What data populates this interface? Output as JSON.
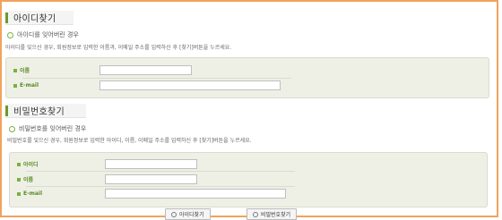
{
  "find_id": {
    "section_title": "아이디찾기",
    "subtitle": "아이디를 잊어버린 경우",
    "description": "아이디를 잊으신 경우, 회원정보로 입력한 이름과, 이메일 주소를 입력하신 후 [찾기]버튼을 누르세요.",
    "fields": [
      {
        "label": "이름",
        "value": ""
      },
      {
        "label": "E-mail",
        "value": ""
      }
    ]
  },
  "find_password": {
    "section_title": "비밀번호찾기",
    "subtitle": "비밀번호를 잊어버린 경우",
    "description": "비밀번호를 잊으신 경우, 회원정보로 입력한 아이디, 이름, 이메일 주소를 입력하신 후 [찾기]버튼을 누르세요.",
    "fields": [
      {
        "label": "아이디",
        "value": ""
      },
      {
        "label": "이름",
        "value": ""
      },
      {
        "label": "E-mail",
        "value": ""
      }
    ]
  },
  "buttons": {
    "find_id": "아이디찾기",
    "find_password": "비밀번호찾기"
  },
  "colors": {
    "accent_green": "#7bb040",
    "frame_orange": "#f1a35c",
    "form_bg": "#eef0e6"
  }
}
